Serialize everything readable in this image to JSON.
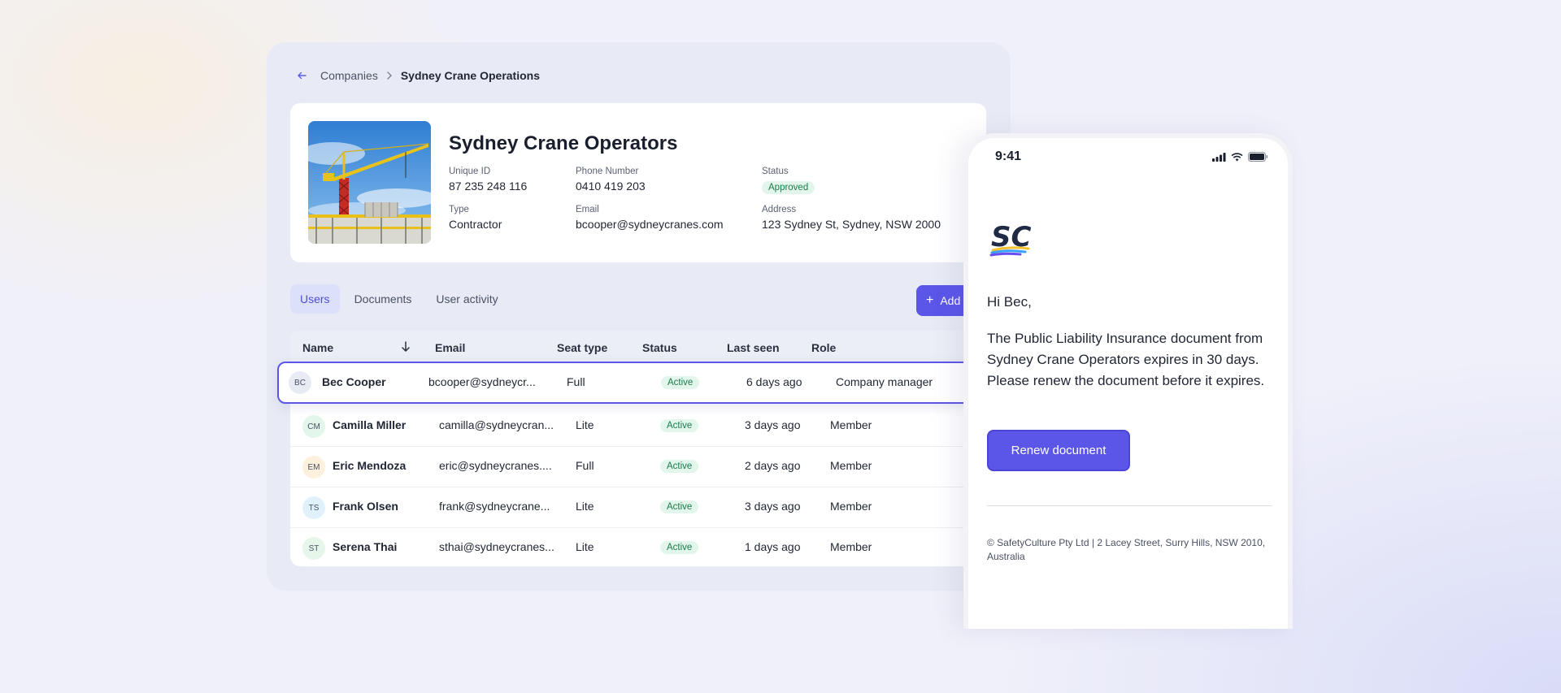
{
  "breadcrumb": {
    "parent": "Companies",
    "current": "Sydney Crane Operations"
  },
  "company": {
    "name": "Sydney Crane Operators",
    "unique_id_label": "Unique ID",
    "unique_id": "87 235 248 116",
    "phone_label": "Phone Number",
    "phone": "0410 419 203",
    "status_label": "Status",
    "status": "Approved",
    "type_label": "Type",
    "type": "Contractor",
    "email_label": "Email",
    "email": "bcooper@sydneycranes.com",
    "address_label": "Address",
    "address": "123 Sydney St, Sydney, NSW 2000"
  },
  "tabs": [
    {
      "label": "Users",
      "active": true
    },
    {
      "label": "Documents",
      "active": false
    },
    {
      "label": "User activity",
      "active": false
    }
  ],
  "add_button": "Add",
  "table": {
    "headers": [
      "Name",
      "Email",
      "Seat type",
      "Status",
      "Last seen",
      "Role"
    ],
    "rows": [
      {
        "initials": "BC",
        "name": "Bec Cooper",
        "email": "bcooper@sydneycr...",
        "seat": "Full",
        "status": "Active",
        "last_seen": "6 days ago",
        "role": "Company manager",
        "avatar_color": "#e8eaf4"
      },
      {
        "initials": "CM",
        "name": "Camilla Miller",
        "email": "camilla@sydneycran...",
        "seat": "Lite",
        "status": "Active",
        "last_seen": "3 days ago",
        "role": "Member",
        "avatar_color": "#e3f6ec"
      },
      {
        "initials": "EM",
        "name": "Eric Mendoza",
        "email": "eric@sydneycranes....",
        "seat": "Full",
        "status": "Active",
        "last_seen": "2 days ago",
        "role": "Member",
        "avatar_color": "#fdf0dc"
      },
      {
        "initials": "TS",
        "name": "Frank Olsen",
        "email": "frank@sydneycrane...",
        "seat": "Lite",
        "status": "Active",
        "last_seen": "3 days ago",
        "role": "Member",
        "avatar_color": "#e0f1fb"
      },
      {
        "initials": "ST",
        "name": "Serena Thai",
        "email": "sthai@sydneycranes...",
        "seat": "Lite",
        "status": "Active",
        "last_seen": "1 days ago",
        "role": "Member",
        "avatar_color": "#e6f6ea"
      }
    ]
  },
  "phone": {
    "time": "9:41",
    "logo_text": "SC",
    "greeting": "Hi Bec,",
    "message": "The Public Liability Insurance document from Sydney Crane Operators expires in 30 days. Please renew the document before it expires.",
    "button": "Renew document",
    "footer": "© SafetyCulture Pty Ltd | 2 Lacey Street, Surry Hills, NSW 2010, Australia"
  },
  "colors": {
    "accent": "#5b56e8",
    "active_green": "#1b7a4b",
    "panel_bg": "#e8ebf5"
  }
}
